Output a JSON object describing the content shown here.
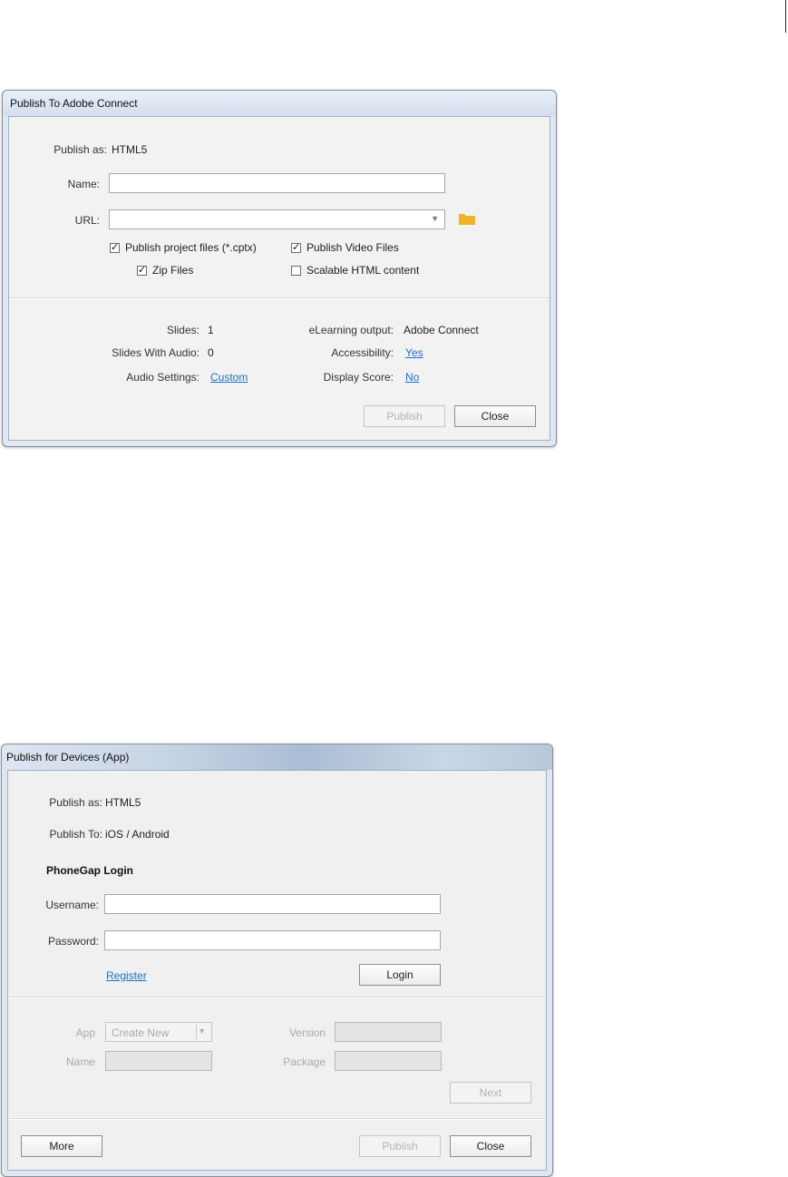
{
  "dialog1": {
    "title": "Publish To Adobe Connect",
    "publish_as_label": "Publish as:",
    "publish_as_value": "HTML5",
    "name_label": "Name:",
    "name_value": "",
    "url_label": "URL:",
    "url_value": "",
    "folder_icon": "folder-icon",
    "checkboxes": {
      "publish_project": {
        "label": "Publish project files (*.cptx)",
        "checked": true
      },
      "publish_video": {
        "label": "Publish Video Files",
        "checked": true
      },
      "zip_files": {
        "label": "Zip Files",
        "checked": true
      },
      "scalable_html": {
        "label": "Scalable HTML content",
        "checked": false
      }
    },
    "info": {
      "slides_label": "Slides:",
      "slides_value": "1",
      "slides_audio_label": "Slides With Audio:",
      "slides_audio_value": "0",
      "audio_settings_label": "Audio Settings:",
      "audio_settings_value": "Custom",
      "elearning_label": "eLearning output:",
      "elearning_value": "Adobe Connect",
      "accessibility_label": "Accessibility:",
      "accessibility_value": "Yes",
      "display_score_label": "Display Score:",
      "display_score_value": "No"
    },
    "buttons": {
      "publish": "Publish",
      "close": "Close"
    }
  },
  "dialog2": {
    "title": "Publish for Devices (App)",
    "publish_as_label": "Publish as:",
    "publish_as_value": "HTML5",
    "publish_to_label": "Publish To:",
    "publish_to_value": "iOS / Android",
    "login_heading": "PhoneGap Login",
    "username_label": "Username:",
    "username_value": "",
    "password_label": "Password:",
    "password_value": "",
    "register_link": "Register",
    "login_button": "Login",
    "app_label": "App",
    "app_value": "Create New",
    "version_label": "Version",
    "version_value": "",
    "name_label": "Name",
    "name_value": "",
    "package_label": "Package",
    "package_value": "",
    "next_button": "Next",
    "more_button": "More",
    "publish_button": "Publish",
    "close_button": "Close"
  },
  "colors": {
    "link": "#1f6fc5",
    "folder": "#f0b429",
    "disabled_text": "#a9a9a9"
  }
}
